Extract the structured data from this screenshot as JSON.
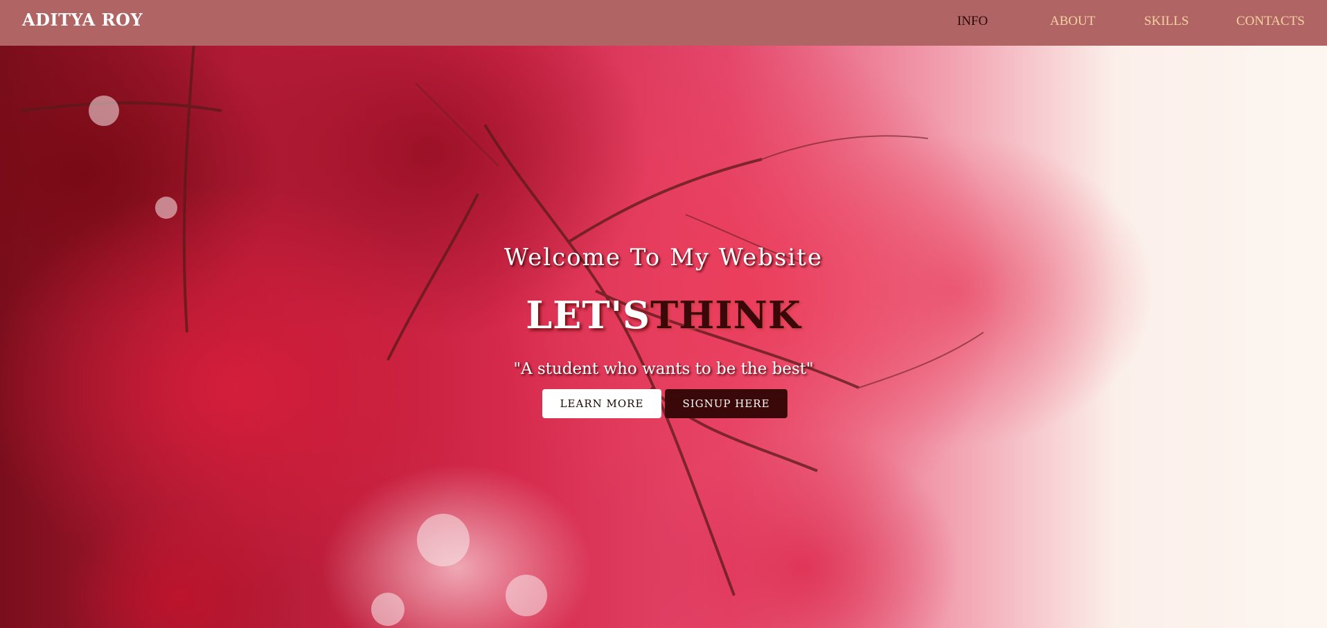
{
  "brand": {
    "name": "ADITYA ROY"
  },
  "nav": {
    "items": [
      {
        "label": "INFO",
        "active": true
      },
      {
        "label": "ABOUT",
        "active": false
      },
      {
        "label": "SKILLS",
        "active": false
      },
      {
        "label": "CONTACTS",
        "active": false
      }
    ]
  },
  "hero": {
    "welcome": "Welcome To My Website",
    "headline_part1": "LET'S",
    "headline_part2": "THINK",
    "tagline": "\"A student who wants to be the best\"",
    "learn_more_label": "LEARN MORE",
    "signup_label": "SIGNUP HERE"
  },
  "colors": {
    "navbar_bg": "#b16464",
    "nav_link": "#f5d2a2",
    "nav_link_active": "#2a0707",
    "signup_button_bg": "#3a0808",
    "learn_button_bg": "#ffffff"
  },
  "background_image": "red-maple-leaves-photo"
}
